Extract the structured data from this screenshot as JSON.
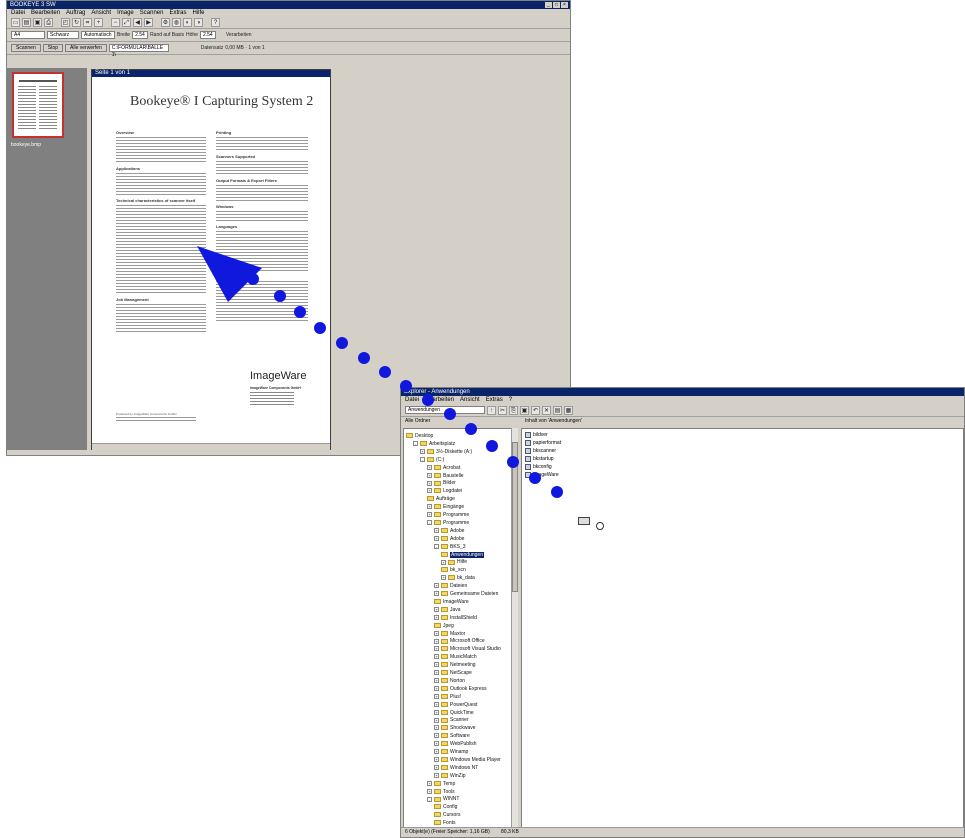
{
  "viewer": {
    "title": "BOOKEYE 3 SW",
    "menu": [
      "Datei",
      "Bearbeiten",
      "Auftrag",
      "Ansicht",
      "Image",
      "Scannen",
      "Extras",
      "Hilfe"
    ],
    "toolbar_icons": [
      "new-icon",
      "open-icon",
      "save-icon",
      "print-icon",
      "scan-icon",
      "rotate-icon",
      "crop-icon",
      "zoom-in-icon",
      "zoom-out-icon",
      "fit-icon",
      "prev-icon",
      "next-icon",
      "settings-icon",
      "color-icon",
      "gray-icon",
      "bw-icon",
      "help-icon"
    ],
    "row2_field1": "A4",
    "row2_field2": "Schwarz",
    "row2_field3": "Automatisch",
    "row2_label1": "Breite",
    "row2_value1": "2.54",
    "row2_label2": "Rand auf Basis",
    "row2_label3": "Höhe",
    "row2_value2": "2.54",
    "row2_label4": "Verarbeiten",
    "row3_btn1": "Scannen",
    "row3_btn2": "Stop",
    "row3_btn3": "Alle verwerfen",
    "row3_field": "C:\\FORMULAR\\BALLE 1\\",
    "row3_label": "Datensatz",
    "row3_info": "0,00 MB · 1 von 1",
    "thumbnail_caption": "bookeye.bmp",
    "doc_title": "Seite 1 von 1",
    "page_heading": "Bookeye® I  Capturing System 2",
    "section_overview": "Overview",
    "section_applications": "Applications",
    "section_features": "Technical characteristics of scanner itself",
    "section_jobmgmt": "Job Management",
    "col2_printing": "Printing",
    "col2_scanner": "Scanners Supported",
    "col2_output": "Output Formats & Export Filters",
    "col2_windows": "Windows",
    "col2_languages": "Languages",
    "col2_system": "System Requirements",
    "logo_text": "ImageWare",
    "logo_address": "ImageWare Components GmbH",
    "footer_note": "Produced by ImageWare Components GmbH"
  },
  "explorer": {
    "title": "Explorer - Anwendungen",
    "menu": [
      "Datei",
      "Bearbeiten",
      "Ansicht",
      "Extras",
      "?"
    ],
    "address": "Anwendungen",
    "left_header": "Alle Ordner",
    "right_header": "Inhalt von 'Anwendungen'",
    "tree": [
      {
        "label": "Desktop",
        "level": 0,
        "exp": ""
      },
      {
        "label": "Arbeitsplatz",
        "level": 1,
        "exp": "-"
      },
      {
        "label": "3½-Diskette (A:)",
        "level": 2,
        "exp": "+"
      },
      {
        "label": "(C:)",
        "level": 2,
        "exp": "-"
      },
      {
        "label": "Acrobat",
        "level": 3,
        "exp": "+"
      },
      {
        "label": "Baustelle",
        "level": 3,
        "exp": "+"
      },
      {
        "label": "Bilder",
        "level": 3,
        "exp": "+"
      },
      {
        "label": "Logdatei",
        "level": 3,
        "exp": "+"
      },
      {
        "label": "Aufträge",
        "level": 3,
        "exp": ""
      },
      {
        "label": "Eingänge",
        "level": 3,
        "exp": "+"
      },
      {
        "label": "Programme",
        "level": 3,
        "exp": "+"
      },
      {
        "label": "Programme",
        "level": 3,
        "exp": "-"
      },
      {
        "label": "Adobe",
        "level": 4,
        "exp": "+"
      },
      {
        "label": "Adobe",
        "level": 4,
        "exp": "+"
      },
      {
        "label": "BKS_3",
        "level": 4,
        "exp": "-"
      },
      {
        "label": "Anwendungen",
        "level": 5,
        "exp": "",
        "sel": true
      },
      {
        "label": "Hilfe",
        "level": 5,
        "exp": "+"
      },
      {
        "label": "bk_scn",
        "level": 5,
        "exp": ""
      },
      {
        "label": "bk_data",
        "level": 5,
        "exp": "+"
      },
      {
        "label": "Dateien",
        "level": 4,
        "exp": "+"
      },
      {
        "label": "Gemeinsame Dateien",
        "level": 4,
        "exp": "+"
      },
      {
        "label": "ImageWare",
        "level": 4,
        "exp": ""
      },
      {
        "label": "Java",
        "level": 4,
        "exp": "+"
      },
      {
        "label": "InstallShield",
        "level": 4,
        "exp": "+"
      },
      {
        "label": "Jpeg",
        "level": 4,
        "exp": ""
      },
      {
        "label": "Maxtor",
        "level": 4,
        "exp": "+"
      },
      {
        "label": "Microsoft Office",
        "level": 4,
        "exp": "+"
      },
      {
        "label": "Microsoft Visual Studio",
        "level": 4,
        "exp": "+"
      },
      {
        "label": "MusicMatch",
        "level": 4,
        "exp": "+"
      },
      {
        "label": "Netmeeting",
        "level": 4,
        "exp": "+"
      },
      {
        "label": "NetScape",
        "level": 4,
        "exp": "+"
      },
      {
        "label": "Norton",
        "level": 4,
        "exp": "+"
      },
      {
        "label": "Outlook Express",
        "level": 4,
        "exp": "+"
      },
      {
        "label": "Plus!",
        "level": 4,
        "exp": "+"
      },
      {
        "label": "PowerQuest",
        "level": 4,
        "exp": "+"
      },
      {
        "label": "QuickTime",
        "level": 4,
        "exp": "+"
      },
      {
        "label": "Scanner",
        "level": 4,
        "exp": "+"
      },
      {
        "label": "Shockwave",
        "level": 4,
        "exp": "+"
      },
      {
        "label": "Software",
        "level": 4,
        "exp": "+"
      },
      {
        "label": "WebPublish",
        "level": 4,
        "exp": "+"
      },
      {
        "label": "Winamp",
        "level": 4,
        "exp": "+"
      },
      {
        "label": "Windows Media Player",
        "level": 4,
        "exp": "+"
      },
      {
        "label": "Windows NT",
        "level": 4,
        "exp": "+"
      },
      {
        "label": "WinZip",
        "level": 4,
        "exp": "+"
      },
      {
        "label": "Temp",
        "level": 3,
        "exp": "+"
      },
      {
        "label": "Tools",
        "level": 3,
        "exp": "+"
      },
      {
        "label": "WINNT",
        "level": 3,
        "exp": "-"
      },
      {
        "label": "Config",
        "level": 4,
        "exp": ""
      },
      {
        "label": "Cursors",
        "level": 4,
        "exp": ""
      },
      {
        "label": "Fonts",
        "level": 4,
        "exp": ""
      }
    ],
    "right_items": [
      "bildver",
      "papierformat",
      "bkscanner",
      "bkstartup",
      "bkconfig",
      "ImageWare"
    ],
    "status": "6 Objekt(e) (Freier Speicher: 1,16 GB)",
    "status_right": "80,3 KB"
  }
}
